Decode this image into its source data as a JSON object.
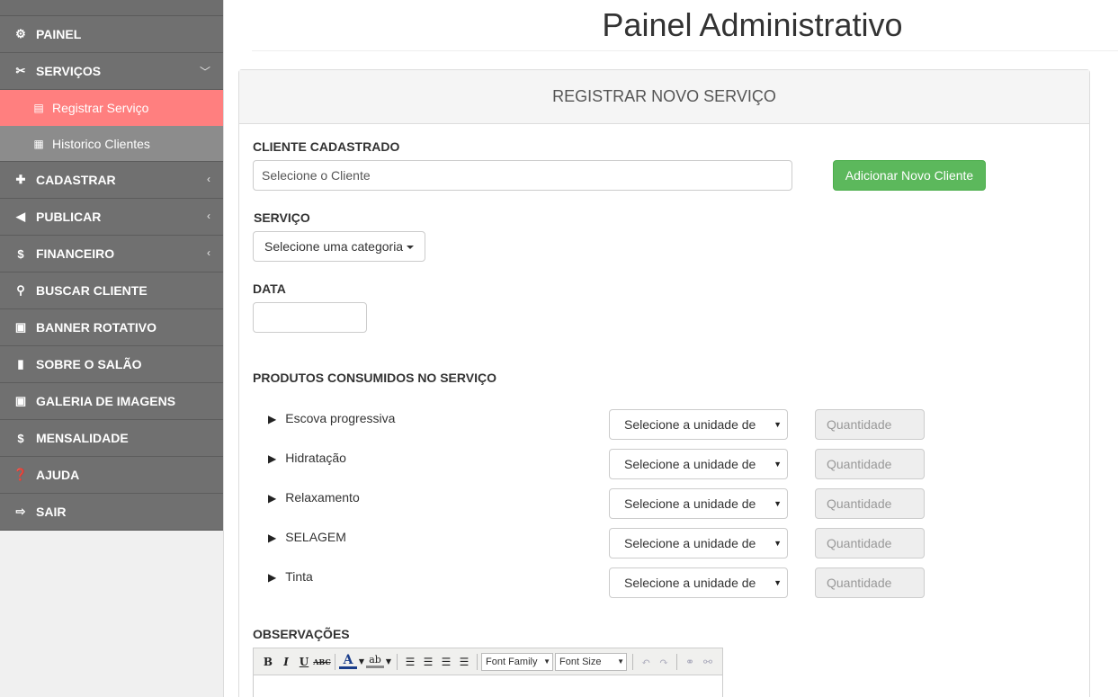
{
  "sidebar": {
    "items": [
      {
        "label": "PAINEL",
        "icon": "dashboard-icon",
        "glyph": "⚙"
      },
      {
        "label": "SERVIÇOS",
        "icon": "scissors-icon",
        "glyph": "✂",
        "chevron": "v"
      },
      {
        "label": "CADASTRAR",
        "icon": "plus-icon",
        "glyph": "+",
        "chevron": "<"
      },
      {
        "label": "PUBLICAR",
        "icon": "bullhorn-icon",
        "glyph": "◀",
        "chevron": "<"
      },
      {
        "label": "FINANCEIRO",
        "icon": "dollar-icon",
        "glyph": "$",
        "chevron": "<"
      },
      {
        "label": "BUSCAR CLIENTE",
        "icon": "search-icon",
        "glyph": "⚲"
      },
      {
        "label": "BANNER ROTATIVO",
        "icon": "image-icon",
        "glyph": "▣"
      },
      {
        "label": "SOBRE O SALÃO",
        "icon": "briefcase-icon",
        "glyph": "▮"
      },
      {
        "label": "GALERIA DE IMAGENS",
        "icon": "image-icon",
        "glyph": "▣"
      },
      {
        "label": "MENSALIDADE",
        "icon": "dollar-icon",
        "glyph": "$"
      },
      {
        "label": "AJUDA",
        "icon": "question-icon",
        "glyph": "?"
      },
      {
        "label": "SAIR",
        "icon": "logout-icon",
        "glyph": "⇨"
      }
    ],
    "submenu": [
      {
        "label": "Registrar Serviço",
        "icon": "file-icon",
        "glyph": "▤",
        "active": true
      },
      {
        "label": "Historico Clientes",
        "icon": "list-icon",
        "glyph": "▦",
        "active": false
      }
    ]
  },
  "page": {
    "title": "Painel Administrativo"
  },
  "panel": {
    "heading": "REGISTRAR NOVO SERVIÇO"
  },
  "form": {
    "client_label": "CLIENTE CADASTRADO",
    "client_value": "Selecione o Cliente",
    "add_client_button": "Adicionar Novo Cliente",
    "service_label": "SERVIÇO",
    "service_dropdown": "Selecione uma categoria",
    "date_label": "DATA",
    "date_value": "",
    "products_label": "PRODUTOS CONSUMIDOS NO SERVIÇO",
    "products": [
      {
        "name": "Escova progressiva",
        "unit": "Selecione a unidade de",
        "qty_placeholder": "Quantidade"
      },
      {
        "name": "Hidratação",
        "unit": "Selecione a unidade de",
        "qty_placeholder": "Quantidade"
      },
      {
        "name": "Relaxamento",
        "unit": "Selecione a unidade de",
        "qty_placeholder": "Quantidade"
      },
      {
        "name": "SELAGEM",
        "unit": "Selecione a unidade de",
        "qty_placeholder": "Quantidade"
      },
      {
        "name": "Tinta",
        "unit": "Selecione a unidade de",
        "qty_placeholder": "Quantidade"
      }
    ],
    "observations_label": "OBSERVAÇÕES"
  },
  "editor": {
    "bold": "B",
    "italic": "I",
    "underline": "U",
    "strike": "ABC",
    "font_color": "A",
    "highlight": "ab",
    "font_family": "Font Family",
    "font_size": "Font Size"
  },
  "colors": {
    "active_submenu": "#ff7f7f",
    "success": "#5cb85c",
    "nav_bg": "#707070"
  }
}
